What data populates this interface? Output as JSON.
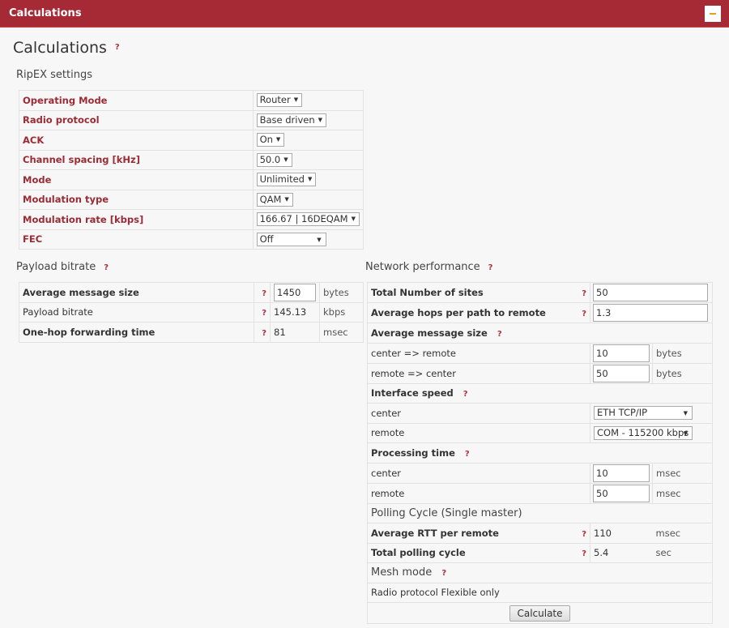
{
  "window": {
    "title": "Calculations",
    "collapse_icon": "minus-icon"
  },
  "page": {
    "title": "Calculations",
    "help": "?"
  },
  "ripex": {
    "heading": "RipEX settings",
    "rows": [
      {
        "label": "Operating Mode",
        "value": "Router"
      },
      {
        "label": "Radio protocol",
        "value": "Base driven"
      },
      {
        "label": "ACK",
        "value": "On"
      },
      {
        "label": "Channel spacing [kHz]",
        "value": "50.0"
      },
      {
        "label": "Mode",
        "value": "Unlimited"
      },
      {
        "label": "Modulation type",
        "value": "QAM"
      },
      {
        "label": "Modulation rate [kbps]",
        "value": "166.67 | 16DEQAM"
      },
      {
        "label": "FEC",
        "value": "Off"
      }
    ],
    "arrow": "▼"
  },
  "payload": {
    "heading": "Payload bitrate",
    "help": "?",
    "rows": [
      {
        "label": "Average message size",
        "help": "?",
        "value": "1450",
        "unit": "bytes"
      },
      {
        "label": "Payload bitrate",
        "help": "?",
        "value": "145.13",
        "unit": "kbps"
      },
      {
        "label": "One-hop forwarding time",
        "help": "?",
        "value": "81",
        "unit": "msec"
      }
    ]
  },
  "network": {
    "heading": "Network performance",
    "help": "?",
    "total_sites": {
      "label": "Total Number of sites",
      "help": "?",
      "value": "50"
    },
    "avg_hops": {
      "label": "Average hops per path to remote",
      "help": "?",
      "value": "1.3"
    },
    "avg_msg": {
      "label": "Average message size",
      "help": "?",
      "center": {
        "label": "center => remote",
        "value": "10",
        "unit": "bytes"
      },
      "remote": {
        "label": "remote => center",
        "value": "50",
        "unit": "bytes"
      }
    },
    "iface": {
      "label": "Interface speed",
      "help": "?",
      "center": {
        "label": "center",
        "value": "ETH TCP/IP"
      },
      "remote": {
        "label": "remote",
        "value": "COM - 115200 kbps"
      }
    },
    "proc": {
      "label": "Processing time",
      "help": "?",
      "center": {
        "label": "center",
        "value": "10",
        "unit": "msec"
      },
      "remote": {
        "label": "remote",
        "value": "50",
        "unit": "msec"
      }
    },
    "polling": {
      "heading": "Polling Cycle (Single master)",
      "rtt": {
        "label": "Average RTT per remote",
        "help": "?",
        "value": "110",
        "unit": "msec"
      },
      "total": {
        "label": "Total polling cycle",
        "help": "?",
        "value": "5.4",
        "unit": "sec"
      }
    },
    "mesh": {
      "heading": "Mesh mode",
      "help": "?",
      "note": "Radio protocol Flexible only"
    },
    "calculate_label": "Calculate"
  }
}
